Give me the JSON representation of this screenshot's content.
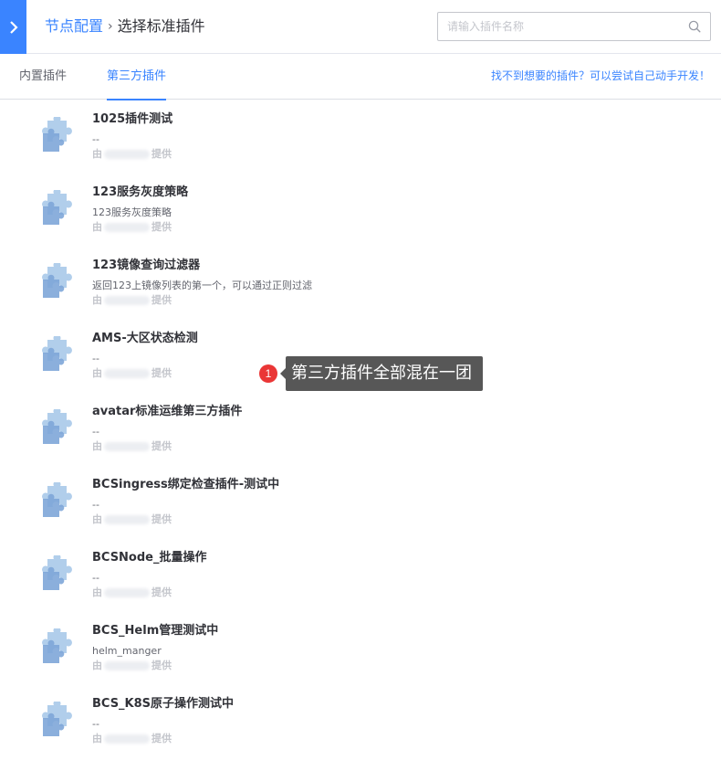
{
  "header": {
    "breadcrumb_parent": "节点配置",
    "breadcrumb_separator": "›",
    "breadcrumb_current": "选择标准插件",
    "back_icon": "chevron-right-icon",
    "search_placeholder": "请输入插件名称",
    "search_value": "",
    "search_icon": "search-icon"
  },
  "tabs": {
    "builtin": "内置插件",
    "third_party": "第三方插件",
    "active": "third_party",
    "help_link": "找不到想要的插件？可以尝试自己动手开发！"
  },
  "plugins": [
    {
      "name": "1025插件测试",
      "desc": "--",
      "provider_prefix": "由",
      "provider_suffix": "提供"
    },
    {
      "name": "123服务灰度策略",
      "desc": "123服务灰度策略",
      "provider_prefix": "由",
      "provider_suffix": "提供"
    },
    {
      "name": "123镜像查询过滤器",
      "desc": "返回123上镜像列表的第一个，可以通过正则过滤",
      "provider_prefix": "由",
      "provider_suffix": "提供"
    },
    {
      "name": "AMS-大区状态检测",
      "desc": "--",
      "provider_prefix": "由",
      "provider_suffix": "提供"
    },
    {
      "name": "avatar标准运维第三方插件",
      "desc": "--",
      "provider_prefix": "由",
      "provider_suffix": "提供"
    },
    {
      "name": "BCSingress绑定检查插件-测试中",
      "desc": "--",
      "provider_prefix": "由",
      "provider_suffix": "提供"
    },
    {
      "name": "BCSNode_批量操作",
      "desc": "--",
      "provider_prefix": "由",
      "provider_suffix": "提供"
    },
    {
      "name": "BCS_Helm管理测试中",
      "desc": "helm_manger",
      "provider_prefix": "由",
      "provider_suffix": "提供"
    },
    {
      "name": "BCS_K8S原子操作测试中",
      "desc": "--",
      "provider_prefix": "由",
      "provider_suffix": "提供"
    }
  ],
  "annotation": {
    "number": "1",
    "text": "第三方插件全部混在一团"
  },
  "colors": {
    "primary": "#3a84ff",
    "annotation_dot": "#ea3636",
    "annotation_bubble": "#575757",
    "plugin_icon": "#a3c5e8"
  }
}
